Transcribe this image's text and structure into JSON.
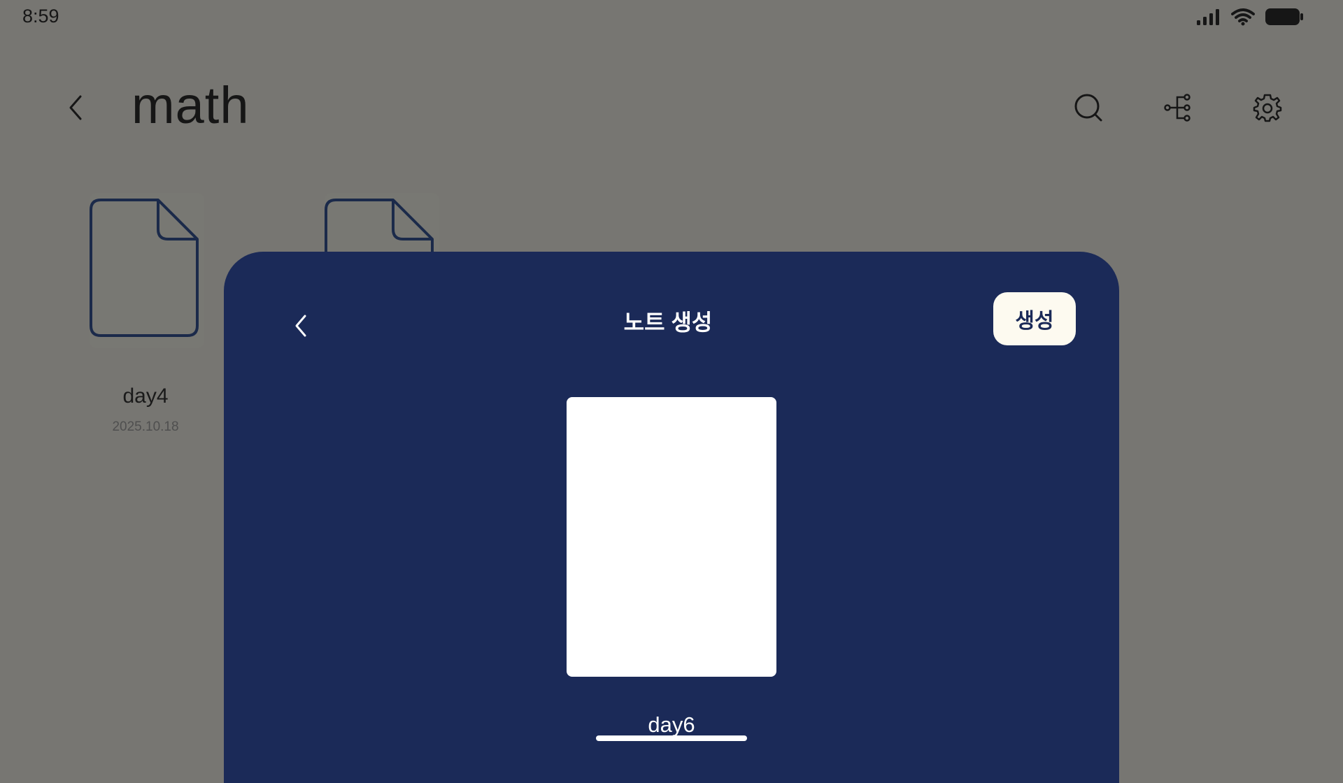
{
  "status_bar": {
    "time": "8:59",
    "icons": [
      "signal-icon",
      "wifi-icon",
      "battery-icon"
    ]
  },
  "header": {
    "title": "math",
    "back_icon": "chevron-left-icon",
    "actions": [
      "search-icon",
      "share-icon",
      "gear-icon"
    ]
  },
  "notes": [
    {
      "name": "day4",
      "date": "2025.10.18"
    },
    {
      "name": "",
      "date": ""
    }
  ],
  "modal": {
    "title": "노트 생성",
    "create_label": "생성",
    "note_name_value": "day6",
    "back_icon": "chevron-left-icon"
  },
  "colors": {
    "background_dim": "#777672",
    "modal_bg": "#1b2a58",
    "create_button_bg": "#fdfaf0",
    "note_outline": "#1b2a4a"
  }
}
